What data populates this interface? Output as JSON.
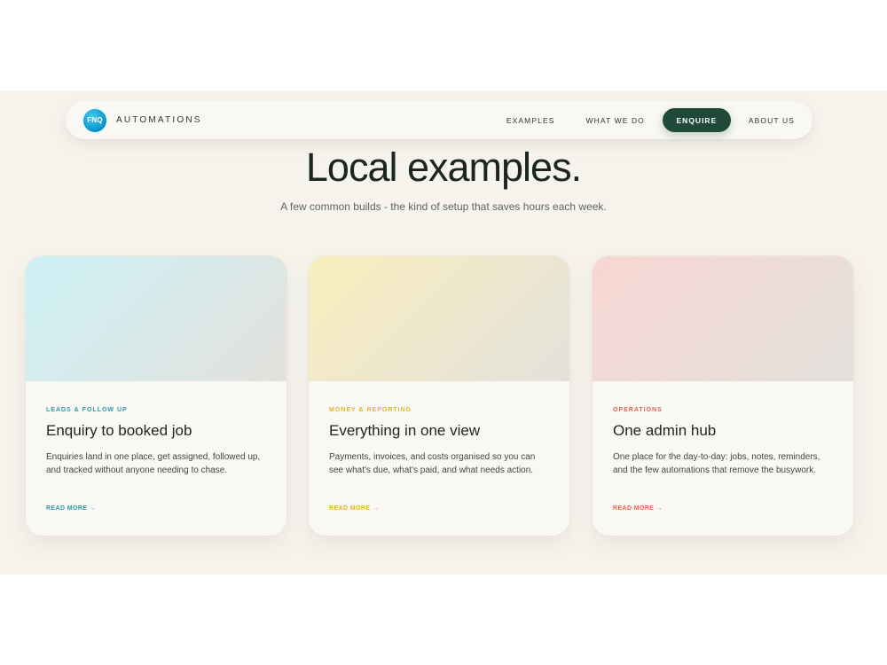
{
  "nav": {
    "logo_text": "FNQ",
    "brand": "AUTOMATIONS",
    "links": [
      {
        "label": "EXAMPLES"
      },
      {
        "label": "WHAT WE DO"
      },
      {
        "label": "ENQUIRE"
      },
      {
        "label": "ABOUT US"
      }
    ]
  },
  "hero": {
    "title": "Local examples.",
    "subtitle": "A few common builds - the kind of setup that saves hours each week."
  },
  "cards": [
    {
      "tag": "LEADS & FOLLOW UP",
      "title": "Enquiry to booked job",
      "description": "Enquiries land in one place, get assigned, followed up, and tracked without anyone needing to chase.",
      "link": "READ MORE →",
      "accent": "#2b9aa6",
      "media_from": "#cdf1f6",
      "media_to": "#e3e1dc"
    },
    {
      "tag": "MONEY & REPORTING",
      "title": "Everything in one view",
      "description": "Payments, invoices, and costs organised so you can see what's due, what's paid, and what needs action.",
      "link": "READ MORE →",
      "accent": "#e0b52a",
      "media_from": "#f9eebd",
      "media_to": "#e3e1dc"
    },
    {
      "tag": "OPERATIONS",
      "title": "One admin hub",
      "description": "One place for the day-to-day: jobs, notes, reminders, and the few automations that remove the busywork.",
      "link": "READ MORE →",
      "accent": "#e0644a",
      "media_from": "#f8d6d3",
      "media_to": "#e3e1dc"
    }
  ]
}
